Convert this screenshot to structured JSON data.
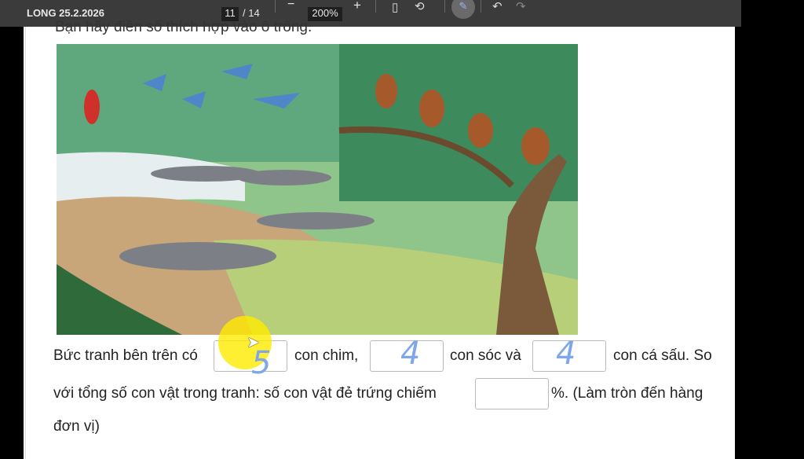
{
  "toolbar": {
    "title": "LONG 25.2.2026",
    "page_current": "11",
    "page_total": "/ 14",
    "zoom_out": "−",
    "zoom": "200%",
    "zoom_in": "+",
    "fit_icon": "fit-page-icon",
    "rotate_icon": "rotate-icon",
    "draw_icon": "draw-icon",
    "undo": "↶",
    "redo": "↷"
  },
  "content": {
    "instruction": "Bạn hãy điền số thích hợp vào ô trống.",
    "t1": "Bức tranh bên trên có",
    "t2": "con chim,",
    "t3": "con sóc và",
    "t4": "con cá sấu. So",
    "t5": "với tổng số con vật trong tranh: số con vật đẻ trứng chiếm",
    "t6": "%. (Làm tròn đến hàng",
    "t7": "đơn vị)",
    "answer_birds": "5",
    "answer_squirrels": "4",
    "answer_crocodiles": "4",
    "answer_percent": ""
  },
  "colors": {
    "ink": "#7ea6ea",
    "toolbar": "#3b3b3b"
  }
}
